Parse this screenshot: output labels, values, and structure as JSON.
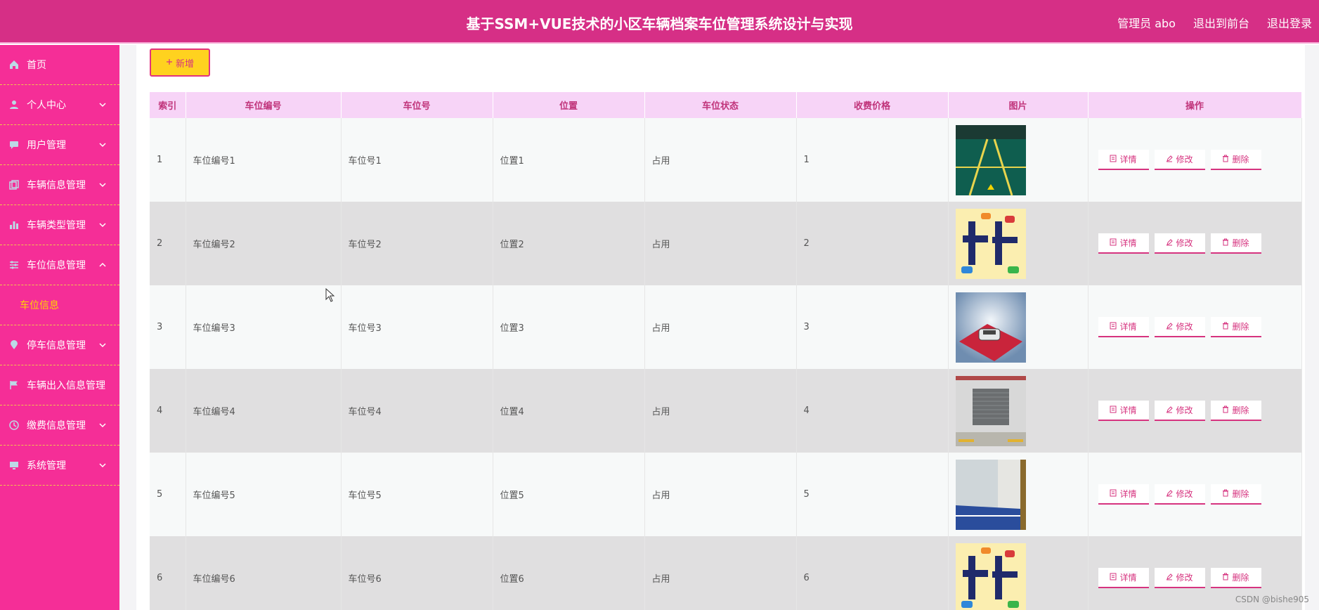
{
  "header": {
    "title": "基于SSM+VUE技术的小区车辆档案车位管理系统设计与实现",
    "links": [
      "管理员 abo",
      "退出到前台",
      "退出登录"
    ]
  },
  "sidebar": {
    "items": [
      {
        "label": "首页",
        "icon": "home-icon",
        "chevron": "none"
      },
      {
        "label": "个人中心",
        "icon": "user-icon",
        "chevron": "down"
      },
      {
        "label": "用户管理",
        "icon": "message-icon",
        "chevron": "down"
      },
      {
        "label": "车辆信息管理",
        "icon": "copy-icon",
        "chevron": "down"
      },
      {
        "label": "车辆类型管理",
        "icon": "chart-icon",
        "chevron": "down"
      },
      {
        "label": "车位信息管理",
        "icon": "sliders-icon",
        "chevron": "up"
      },
      {
        "label": "车位信息",
        "icon": "",
        "chevron": "none",
        "submenu": true
      },
      {
        "label": "停车信息管理",
        "icon": "location-icon",
        "chevron": "down"
      },
      {
        "label": "车辆出入信息管理",
        "icon": "flag-icon",
        "chevron": "none"
      },
      {
        "label": "缴费信息管理",
        "icon": "clock-icon",
        "chevron": "down"
      },
      {
        "label": "系统管理",
        "icon": "monitor-icon",
        "chevron": "down"
      }
    ]
  },
  "toolbar": {
    "add_label": "新增",
    "add_icon": "plus-icon"
  },
  "table": {
    "columns": [
      "索引",
      "车位编号",
      "车位号",
      "位置",
      "车位状态",
      "收费价格",
      "图片",
      "操作"
    ],
    "rows": [
      {
        "index": "1",
        "code": "车位编号1",
        "number": "车位号1",
        "location": "位置1",
        "status": "占用",
        "price": "1",
        "image": "parking-lot-green"
      },
      {
        "index": "2",
        "code": "车位编号2",
        "number": "车位号2",
        "location": "位置2",
        "status": "占用",
        "price": "2",
        "image": "chewei-poster"
      },
      {
        "index": "3",
        "code": "车位编号3",
        "number": "车位号3",
        "location": "位置3",
        "status": "占用",
        "price": "3",
        "image": "car-snow"
      },
      {
        "index": "4",
        "code": "车位编号4",
        "number": "车位号4",
        "location": "位置4",
        "status": "占用",
        "price": "4",
        "image": "garage-gate"
      },
      {
        "index": "5",
        "code": "车位编号5",
        "number": "车位号5",
        "location": "位置5",
        "status": "占用",
        "price": "5",
        "image": "garage-blue-floor"
      },
      {
        "index": "6",
        "code": "车位编号6",
        "number": "车位号6",
        "location": "位置6",
        "status": "占用",
        "price": "6",
        "image": "chewei-poster"
      }
    ],
    "actions": [
      "详情",
      "修改",
      "删除"
    ],
    "action_icons": [
      "detail-icon",
      "edit-icon",
      "delete-icon"
    ]
  },
  "watermark": "CSDN @bishe905",
  "colors": {
    "header_bg": "#d62f86",
    "sidebar_bg": "#f52e97",
    "accent_yellow": "#ffd21f",
    "table_header_bg": "#f7d4f7",
    "action_pink": "#d6337f"
  }
}
